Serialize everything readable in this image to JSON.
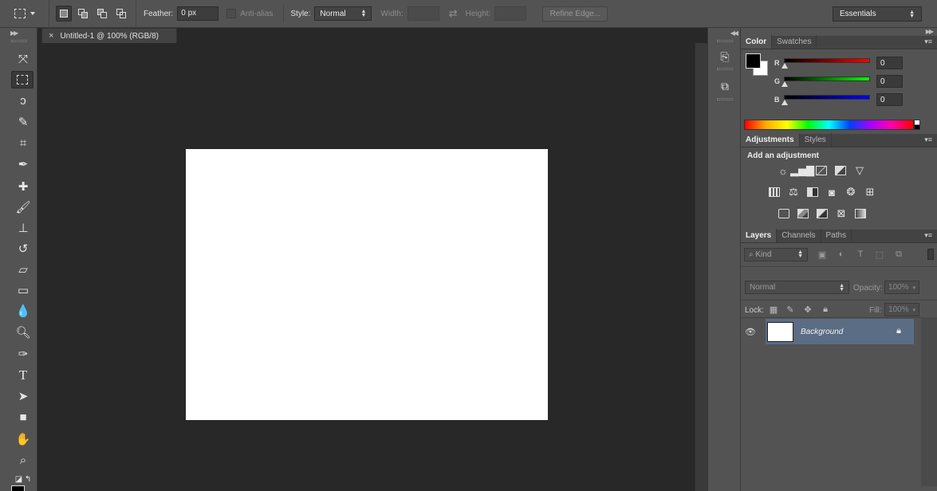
{
  "options_bar": {
    "feather_label": "Feather:",
    "feather_value": "0 px",
    "antialias_label": "Anti-alias",
    "style_label": "Style:",
    "style_value": "Normal",
    "width_label": "Width:",
    "height_label": "Height:",
    "refine_edge_label": "Refine Edge...",
    "workspace": "Essentials"
  },
  "document": {
    "tab_title": "Untitled-1 @ 100% (RGB/8)",
    "canvas_color": "#ffffff"
  },
  "color_panel": {
    "tabs": [
      "Color",
      "Swatches"
    ],
    "channels": [
      {
        "label": "R",
        "value": "0",
        "gradient": "linear-gradient(to right,#000,#ff0000)"
      },
      {
        "label": "G",
        "value": "0",
        "gradient": "linear-gradient(to right,#000,#00ff00)"
      },
      {
        "label": "B",
        "value": "0",
        "gradient": "linear-gradient(to right,#000,#0000ff)"
      }
    ],
    "foreground": "#000000",
    "background": "#ffffff"
  },
  "adjustments_panel": {
    "tabs": [
      "Adjustments",
      "Styles"
    ],
    "title": "Add an adjustment"
  },
  "layers_panel": {
    "tabs": [
      "Layers",
      "Channels",
      "Paths"
    ],
    "filter_kind": "Kind",
    "blend_mode": "Normal",
    "opacity_label": "Opacity:",
    "opacity_value": "100%",
    "lock_label": "Lock:",
    "fill_label": "Fill:",
    "fill_value": "100%",
    "layers": [
      {
        "name": "Background",
        "selected": true,
        "locked": true
      }
    ]
  },
  "colors": {
    "ui_panel": "#535353",
    "ui_dark": "#282828",
    "layer_selected": "#5b6c85"
  }
}
